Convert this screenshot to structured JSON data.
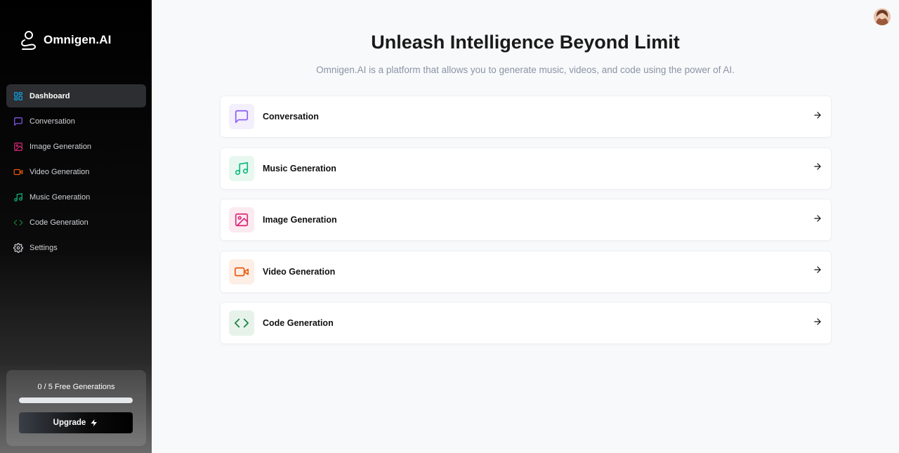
{
  "app": {
    "name": "Omnigen.AI"
  },
  "sidebar": {
    "items": [
      {
        "label": "Dashboard",
        "icon": "dashboard-icon",
        "color": "#0ea5e9",
        "active": true
      },
      {
        "label": "Conversation",
        "icon": "message-square-icon",
        "color": "#8b5cf6"
      },
      {
        "label": "Image Generation",
        "icon": "image-icon",
        "color": "#db2777"
      },
      {
        "label": "Video Generation",
        "icon": "video-icon",
        "color": "#ea580c"
      },
      {
        "label": "Music Generation",
        "icon": "music-icon",
        "color": "#10b981"
      },
      {
        "label": "Code Generation",
        "icon": "code-icon",
        "color": "#15803d"
      },
      {
        "label": "Settings",
        "icon": "gear-icon",
        "color": "#d1d5db"
      }
    ],
    "usage": {
      "text": "0 / 5 Free Generations",
      "used": 0,
      "limit": 5
    },
    "upgrade_label": "Upgrade"
  },
  "main": {
    "title": "Unleash Intelligence Beyond Limit",
    "subtitle": "Omnigen.AI is a platform that allows you to generate music, videos, and code using the power of AI.",
    "cards": [
      {
        "label": "Conversation",
        "icon": "message-square-icon",
        "color": "#8b5cf6",
        "bg": "#f3effd"
      },
      {
        "label": "Music Generation",
        "icon": "music-icon",
        "color": "#10b981",
        "bg": "#e8f8f1"
      },
      {
        "label": "Image Generation",
        "icon": "image-icon",
        "color": "#db2777",
        "bg": "#fceaf1"
      },
      {
        "label": "Video Generation",
        "icon": "video-icon",
        "color": "#ea580c",
        "bg": "#fdefe6"
      },
      {
        "label": "Code Generation",
        "icon": "code-icon",
        "color": "#15803d",
        "bg": "#e7f3ea"
      }
    ]
  }
}
